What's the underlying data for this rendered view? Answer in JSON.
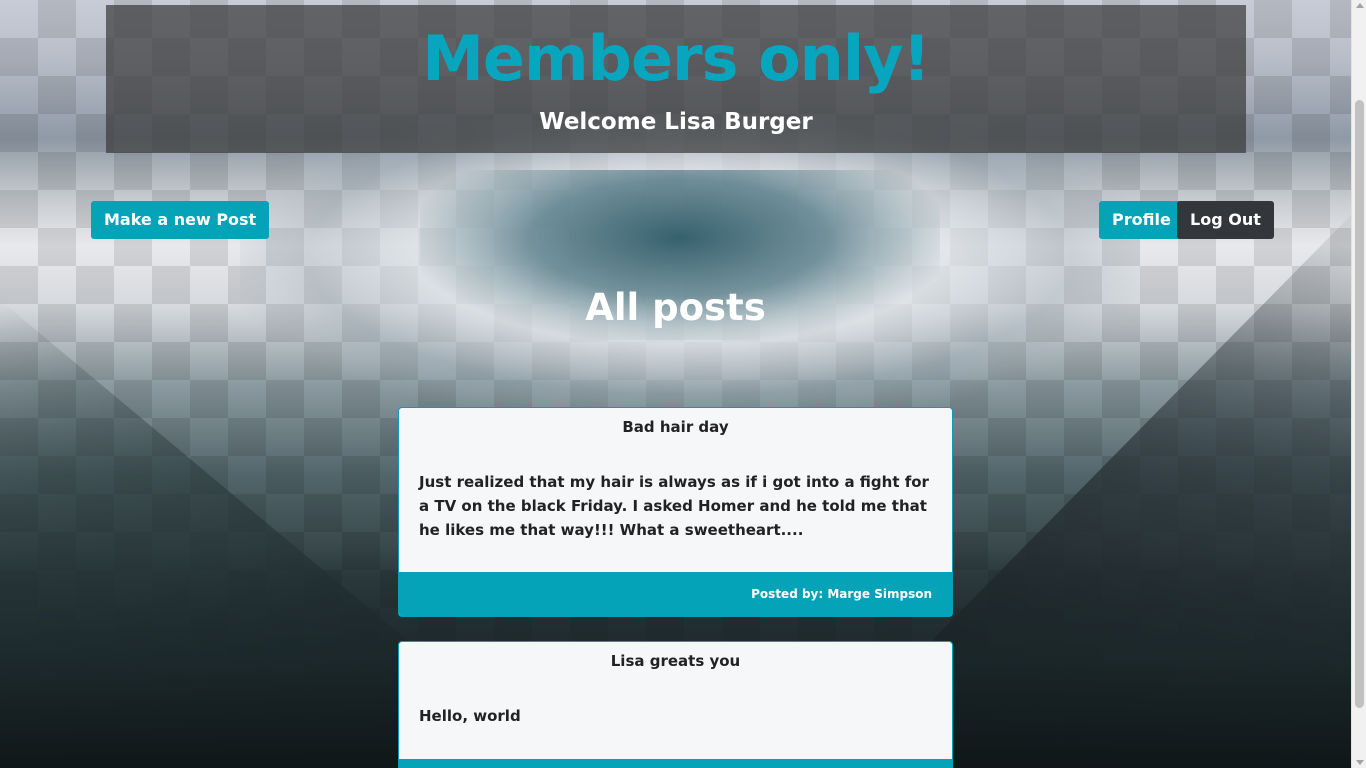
{
  "header": {
    "site_title": "Members only!",
    "welcome": "Welcome Lisa Burger"
  },
  "nav": {
    "new_post": "Make a new Post",
    "profile": "Profile",
    "logout": "Log Out"
  },
  "main": {
    "heading": "All posts",
    "posts": [
      {
        "title": "Bad hair day",
        "body": "Just realized that my hair is always as if i got into a fight for a TV on the black Friday. I asked Homer and he told me that he likes me that way!!! What a sweetheart....",
        "author": "Posted by: Marge Simpson"
      },
      {
        "title": "Lisa greats you",
        "body": "Hello, world",
        "author": ""
      }
    ]
  },
  "colors": {
    "accent": "#05a3b8",
    "dark_button": "#33373b"
  }
}
